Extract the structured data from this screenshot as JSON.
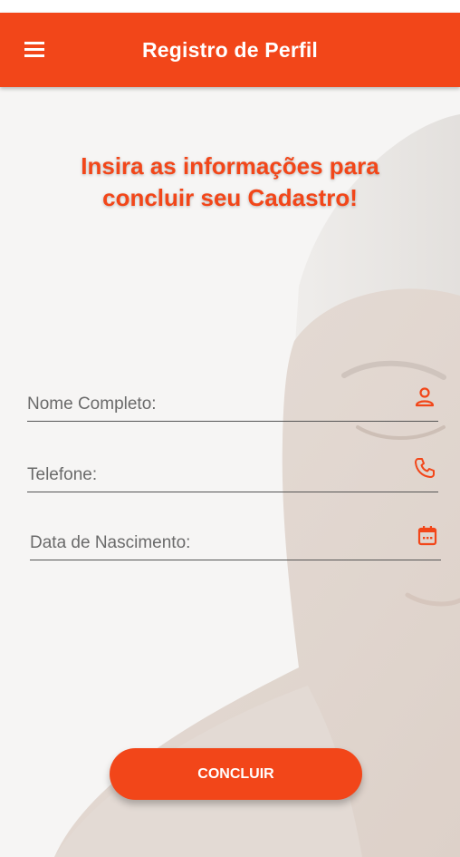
{
  "app_bar": {
    "title": "Registro de Perfil",
    "menu_icon": "menu-icon"
  },
  "headline": {
    "line1": "Insira as informações para",
    "line2": "concluir seu Cadastro!"
  },
  "form": {
    "full_name": {
      "placeholder": "Nome Completo:",
      "value": "",
      "icon": "person-icon"
    },
    "phone": {
      "placeholder": "Telefone:",
      "value": "",
      "icon": "phone-icon"
    },
    "birth_date": {
      "placeholder": "Data de Nascimento:",
      "value": "",
      "icon": "calendar-icon"
    }
  },
  "submit": {
    "label": "CONCLUIR"
  },
  "colors": {
    "primary": "#f24619",
    "background": "#f6f5f4",
    "text_muted": "#555555"
  }
}
